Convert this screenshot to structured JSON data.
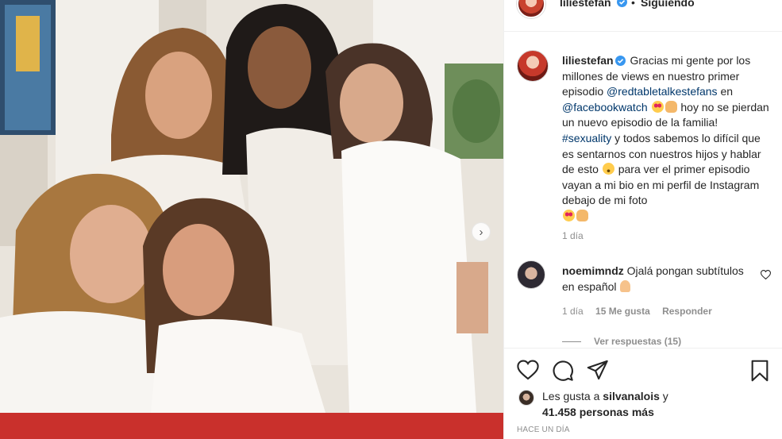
{
  "header": {
    "username": "liliestefan",
    "separator": "•",
    "follow_status": "Siguiendo"
  },
  "caption": {
    "username": "liliestefan",
    "text_1": "Gracias mi gente por los millones de views en nuestro primer episodio",
    "mention_1": "@redtabletalkestefans",
    "text_2": "en",
    "mention_2": "@facebookwatch",
    "text_3": "hoy no se pierdan un nuevo episodio de la familia!",
    "hashtag": "#sexuality",
    "text_4": "y todos sabemos lo difícil que es sentarnos con nuestros hijos y hablar de esto",
    "text_5": "para ver el primer episodio vayan a mi bio en mi perfil de Instagram debajo de mi foto",
    "time": "1 día"
  },
  "comment": {
    "username": "noemimndz",
    "text": "Ojalá pongan subtítulos en español",
    "time": "1 día",
    "likes": "15 Me gusta",
    "reply": "Responder",
    "view_replies": "Ver respuestas (15)"
  },
  "likes": {
    "prefix": "Les gusta a",
    "user": "silvanalois",
    "conj": "y",
    "count": "41.458 personas más"
  },
  "posted": "HACE UN DÍA",
  "icons": [
    "heart-icon",
    "comment-icon",
    "share-icon",
    "bookmark-icon",
    "verified-icon",
    "chevron-right-icon"
  ],
  "colors": {
    "link": "#00376b",
    "verified": "#3897f0",
    "muted": "#8e8e8e",
    "text": "#262626"
  }
}
